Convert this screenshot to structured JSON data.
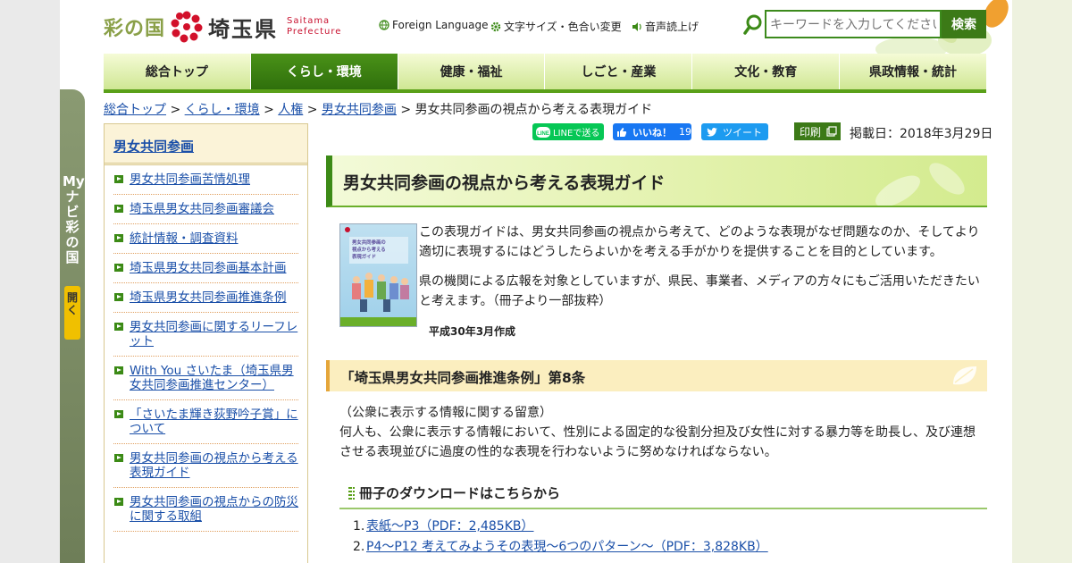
{
  "header": {
    "logo_sai": "彩の国",
    "logo_pref": "埼玉県",
    "logo_en_line1": "Saitama",
    "logo_en_line2": "Prefecture",
    "util": {
      "foreign": "Foreign Language",
      "textsize": "文字サイズ・色合い変更",
      "speech": "音声読上げ"
    },
    "search_placeholder": "キーワードを入力してください",
    "search_button": "検索"
  },
  "nav": [
    {
      "label": "総合トップ",
      "active": false
    },
    {
      "label": "くらし・環境",
      "active": true
    },
    {
      "label": "健康・福祉",
      "active": false
    },
    {
      "label": "しごと・産業",
      "active": false
    },
    {
      "label": "文化・教育",
      "active": false
    },
    {
      "label": "県政情報・統計",
      "active": false
    }
  ],
  "breadcrumb": {
    "items": [
      "総合トップ",
      "くらし・環境",
      "人権",
      "男女共同参画"
    ],
    "current": "男女共同参画の視点から考える表現ガイド",
    "sep": ">"
  },
  "mynavi": {
    "label": "Myナビ彩の国",
    "open": "開く"
  },
  "sidebar": {
    "heading": "男女共同参画",
    "items": [
      "男女共同参画苦情処理",
      "埼玉県男女共同参画審議会",
      "統計情報・調査資料",
      "埼玉県男女共同参画基本計画",
      "埼玉県男女共同参画推進条例",
      "男女共同参画に関するリーフレット",
      "With You さいたま（埼玉県男女共同参画推進センター）",
      "「さいたま輝き荻野吟子賞」について",
      "男女共同参画の視点から考える表現ガイド",
      "男女共同参画の視点からの防災に関する取組"
    ]
  },
  "social": {
    "line": "LINEで送る",
    "fb_like": "いいね！",
    "fb_count": "19",
    "tweet": "ツイート",
    "print": "印刷",
    "pubdate": "掲載日：2018年3月29日"
  },
  "main": {
    "title": "男女共同参画の視点から考える表現ガイド",
    "para1": "この表現ガイドは、男女共同参画の視点から考えて、どのような表現がなぜ問題なのか、そしてより適切に表現するにはどうしたらよいかを考える手がかりを提供することを目的としています。",
    "para2": "県の機関による広報を対象としていますが、県民、事業者、メディアの方々にもご活用いただきたいと考えます。（冊子より一部抜粋）",
    "caption": "平成30年3月作成",
    "booklet_title": "男女共同参画の視点から考える表現ガイド",
    "section_title": "「埼玉県男女共同参画推進条例」第8条",
    "section_line1": "（公衆に表示する情報に関する留意）",
    "section_line2": "何人も、公衆に表示する情報において、性別による固定的な役割分担及び女性に対する暴力等を助長し、及び連想させる表現並びに過度の性的な表現を行わないように努めなければならない。",
    "download_title": "冊子のダウンロードはこちらから",
    "downloads": [
      {
        "num": "1.",
        "label": "表紙～P3（PDF：2,485KB）"
      },
      {
        "num": "2.",
        "label": "P4～P12 考えてみようその表現～6つのパターン～（PDF：3,828KB）"
      }
    ]
  }
}
